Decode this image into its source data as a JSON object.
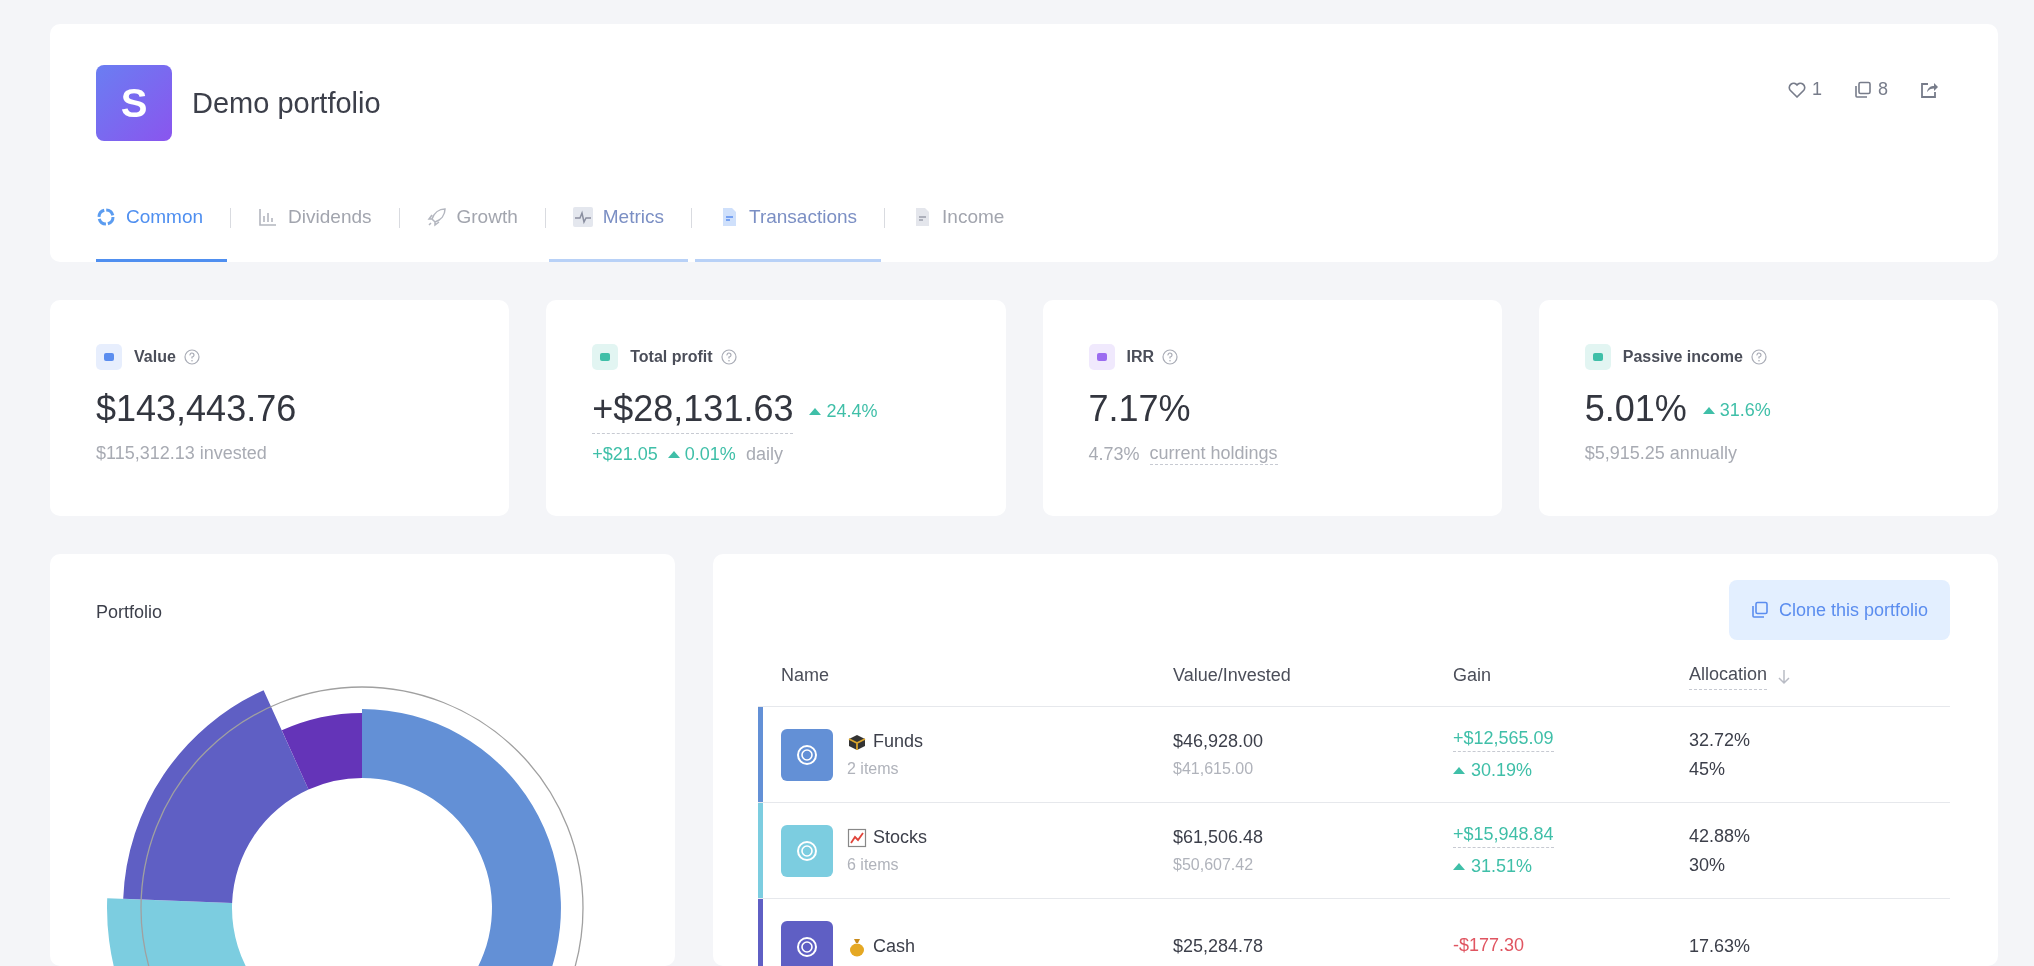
{
  "header": {
    "logo": "S",
    "title": "Demo portfolio",
    "likes": "1",
    "copies": "8"
  },
  "tabs": [
    {
      "label": "Common",
      "selected": true,
      "highlighted": false
    },
    {
      "label": "Dividends",
      "selected": false,
      "highlighted": false
    },
    {
      "label": "Growth",
      "selected": false,
      "highlighted": false
    },
    {
      "label": "Metrics",
      "selected": false,
      "highlighted": true
    },
    {
      "label": "Transactions",
      "selected": false,
      "highlighted": true
    },
    {
      "label": "Income",
      "selected": false,
      "highlighted": false
    }
  ],
  "stats": [
    {
      "label": "Value",
      "color": "#5b8def",
      "value": "$143,443.76",
      "dashed": false,
      "sub": [
        {
          "kind": "plain",
          "text": "$115,312.13 invested"
        }
      ]
    },
    {
      "label": "Total profit",
      "color": "#3fbfa8",
      "value": "+$28,131.63",
      "dashed": true,
      "change": "24.4%",
      "sub": [
        {
          "kind": "positive",
          "text": "+$21.05"
        },
        {
          "kind": "positive-change",
          "text": "0.01%"
        },
        {
          "kind": "plain",
          "text": "daily"
        }
      ]
    },
    {
      "label": "IRR",
      "color": "#9b6cf0",
      "value": "7.17%",
      "dashed": false,
      "sub": [
        {
          "kind": "plain",
          "text": "4.73%"
        },
        {
          "kind": "dashed",
          "text": "current holdings"
        }
      ]
    },
    {
      "label": "Passive income",
      "color": "#3fbfa8",
      "value": "5.01%",
      "dashed": false,
      "change": "31.6%",
      "sub": [
        {
          "kind": "plain",
          "text": "$5,915.25 annually"
        }
      ]
    }
  ],
  "portfolio_chart": {
    "title": "Portfolio"
  },
  "holdings": {
    "button": "Clone this portfolio",
    "columns": [
      {
        "label": "Name",
        "sorted": false
      },
      {
        "label": "Value/Invested",
        "sorted": false
      },
      {
        "label": "Gain",
        "sorted": false
      },
      {
        "label": "Allocation",
        "sorted": true
      }
    ],
    "rows": [
      {
        "name": "Funds",
        "count": "2 items",
        "color": "#6390d6",
        "value": "$46,928.00",
        "invested": "$41,615.00",
        "negative": false,
        "gain": "+$12,565.09",
        "gain_change": "30.19%",
        "allocation": "32.72%",
        "target": "45%"
      },
      {
        "name": "Stocks",
        "count": "6 items",
        "color": "#7ccde0",
        "value": "$61,506.48",
        "invested": "$50,607.42",
        "negative": false,
        "gain": "+$15,948.84",
        "gain_change": "31.51%",
        "allocation": "42.88%",
        "target": "30%"
      },
      {
        "name": "Cash",
        "color": "#5f5fc4",
        "value": "$25,284.78",
        "negative": true,
        "gain": "-$177.30",
        "allocation": "17.63%"
      }
    ]
  }
}
